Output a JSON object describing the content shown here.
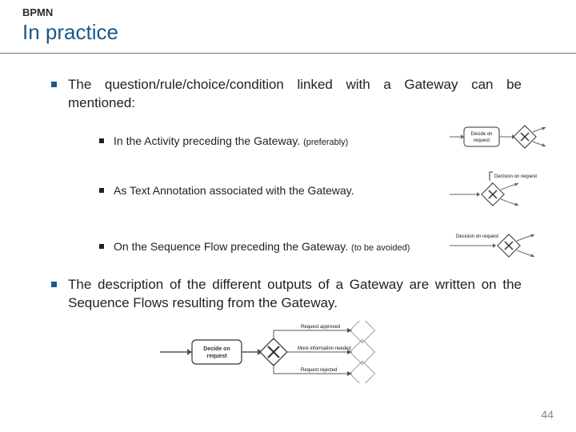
{
  "header": {
    "supertitle": "BPMN",
    "title": "In practice"
  },
  "bullets": {
    "b1": "The question/rule/choice/condition linked with a Gateway can be mentioned:",
    "b1a": "In the Activity preceding the Gateway. ",
    "b1a_note": "(preferably)",
    "b1b": "As Text Annotation associated with the Gateway.",
    "b1c": "On the Sequence Flow preceding the Gateway. ",
    "b1c_note": "(to be avoided)",
    "b2": "The description of the different outputs of a Gateway are written on the Sequence Flows resulting from the Gateway."
  },
  "diagrams": {
    "activity_label": "Decide on request",
    "annotation_label": "Decision on request",
    "flow_label": "Decision on request",
    "out_top": "Request approved",
    "out_mid": "More information needed",
    "out_bot": "Request rejected"
  },
  "page_number": "44"
}
